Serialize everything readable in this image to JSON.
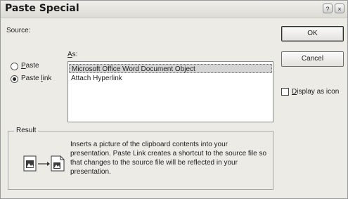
{
  "window": {
    "title": "Paste Special",
    "help_glyph": "?",
    "close_glyph": "×"
  },
  "source": {
    "label": "Source:"
  },
  "as_label": {
    "key": "A",
    "rest": "s:"
  },
  "paste_options": [
    {
      "key": "P",
      "rest": "aste",
      "selected": false
    },
    {
      "key": "",
      "pre": "Paste ",
      "rest_key": "l",
      "rest": "ink",
      "selected": true
    }
  ],
  "as_list": {
    "items": [
      {
        "label": "Microsoft Office Word Document Object",
        "selected": true
      },
      {
        "label": "Attach Hyperlink",
        "selected": false
      }
    ]
  },
  "buttons": {
    "ok": "OK",
    "cancel": "Cancel"
  },
  "display_as_icon": {
    "key": "D",
    "rest": "isplay as icon",
    "checked": false
  },
  "result": {
    "title": "Result",
    "text": "Inserts a picture of the clipboard contents into your presentation. Paste Link creates a shortcut to the source file so that changes to the source file will be reflected in your presentation.",
    "icon": "paste-link-icon"
  },
  "colors": {
    "dialog_bg": "#ecebe6",
    "selected_item_bg": "#d4d4d4"
  }
}
